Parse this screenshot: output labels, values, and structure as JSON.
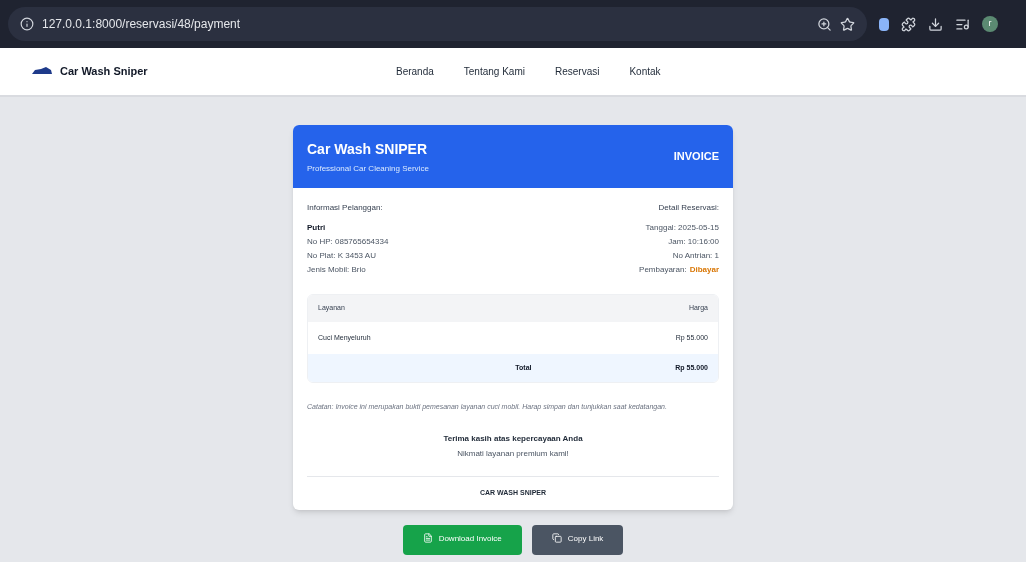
{
  "browser": {
    "url": "127.0.0.1:8000/reservasi/48/payment",
    "avatar": "r"
  },
  "navbar": {
    "brand": "Car Wash Sniper",
    "links": [
      "Beranda",
      "Tentang Kami",
      "Reservasi",
      "Kontak"
    ]
  },
  "invoice": {
    "company": "Car Wash SNIPER",
    "tagline": "Professional Car Cleaning Service",
    "label": "INVOICE",
    "customer": {
      "heading": "Informasi Pelanggan:",
      "name": "Putri",
      "lines": [
        "No HP: 085765654334",
        "No Plat: K 3453 AU",
        "Jenis Mobil: Brio"
      ]
    },
    "reservation": {
      "heading": "Detail Reservasi:",
      "lines": [
        "Tanggal: 2025-05-15",
        "Jam: 10:16:00",
        "No Antrian: 1"
      ],
      "payment_label": "Pembayaran:",
      "payment_status": "Dibayar"
    },
    "table": {
      "columns": [
        "Layanan",
        "Harga"
      ],
      "rows": [
        {
          "service": "Cuci Menyeluruh",
          "price": "Rp 55.000"
        }
      ],
      "total_label": "Total",
      "total": "Rp 55.000"
    },
    "note": "Catatan: Invoice ini merupakan bukti pemesanan layanan cuci mobil. Harap simpan dan tunjukkan saat kedatangan.",
    "thanks": "Terima kasih atas kepercayaan Anda",
    "subthanks": "Nikmati layanan premium kami!",
    "footer": "CAR WASH SNIPER"
  },
  "buttons": [
    {
      "label": "Download Invoice",
      "kind": "download"
    },
    {
      "label": "Copy Link",
      "kind": "copy"
    }
  ]
}
